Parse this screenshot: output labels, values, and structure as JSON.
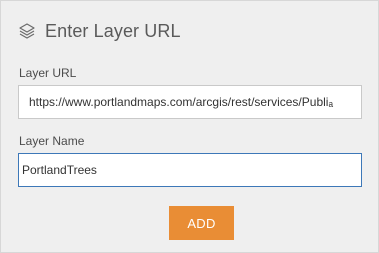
{
  "dialog": {
    "title": "Enter Layer URL",
    "header_icon": "layers-icon"
  },
  "form": {
    "layer_url": {
      "label": "Layer URL",
      "value": "https://www.portlandmaps.com/arcgis/rest/services/Publiₐ"
    },
    "layer_name": {
      "label": "Layer Name",
      "value": "PortlandTrees"
    }
  },
  "actions": {
    "add_label": "ADD"
  },
  "colors": {
    "panel_background": "#efefef",
    "button_accent": "#e98d35",
    "focus_border": "#3d78b8"
  }
}
